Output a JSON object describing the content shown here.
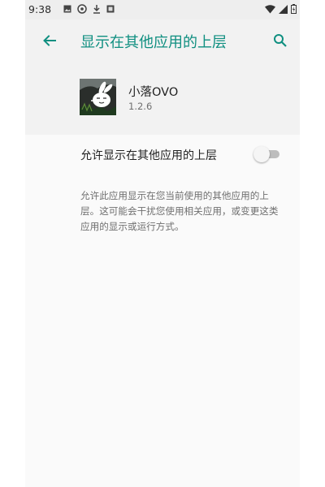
{
  "status_bar": {
    "time": "9:38",
    "left_icons": [
      "image-icon",
      "vpn-key-icon",
      "download-icon",
      "notification-icon"
    ],
    "right_icons": [
      "wifi-icon",
      "signal-icon",
      "battery-charging-icon"
    ]
  },
  "app_bar": {
    "title": "显示在其他应用的上层",
    "back_icon": "arrow-back-icon",
    "search_icon": "search-icon"
  },
  "app_info": {
    "name": "小落OVO",
    "version": "1.2.6"
  },
  "permission": {
    "title": "允许显示在其他应用的上层",
    "enabled": false,
    "summary": "允许此应用显示在您当前使用的其他应用的上层。这可能会干扰您使用相关应用，或变更这类应用的显示或运行方式。"
  },
  "colors": {
    "accent": "#0f8f80",
    "header_bg": "#f2f2f2",
    "content_bg": "#fafafa",
    "switch_off_track": "#bdbdbd"
  }
}
